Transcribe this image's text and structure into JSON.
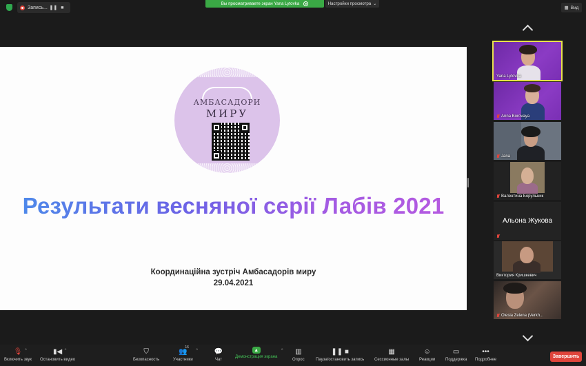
{
  "topbar": {
    "recording_label": "Запись...",
    "share_banner": "Вы просматриваете экран Yana Lytovka",
    "view_options": "Настройки просмотра",
    "view_button": "Вид"
  },
  "slide": {
    "logo_top": "АМБАСАДОРИ",
    "logo_bottom": "МИРУ",
    "title": "Результати весняної серії Лабів 2021",
    "subtitle": "Координаційна зустріч Амбасадорів миру",
    "date": "29.04.2021"
  },
  "gallery": {
    "participants": [
      {
        "name": "Yana Lytovka",
        "muted": false
      },
      {
        "name": "Anna Borovaya",
        "muted": true
      },
      {
        "name": "Jana",
        "muted": true
      },
      {
        "name": "Валентина Борульник",
        "muted": true
      },
      {
        "name": "Альона Жукова",
        "muted": true
      },
      {
        "name": "Виктория Кришкевич",
        "muted": false
      },
      {
        "name": "Olesia Zelena (Verkh...",
        "muted": true
      }
    ]
  },
  "toolbar": {
    "unmute": "Включить звук",
    "stop_video": "Остановить видео",
    "security": "Безопасность",
    "participants": "Участники",
    "participants_count": "16",
    "chat": "Чат",
    "share_screen": "Демонстрация экрана",
    "polls": "Опрос",
    "pause_recording": "Пауза/остановить запись",
    "breakout_rooms": "Сессионные залы",
    "reactions": "Реакции",
    "support": "Поддержка",
    "more": "Подробнее",
    "end": "Завершить"
  },
  "colors": {
    "share_green": "#3aa945",
    "end_red": "#e0453c",
    "active_speaker": "#e9e24d"
  }
}
